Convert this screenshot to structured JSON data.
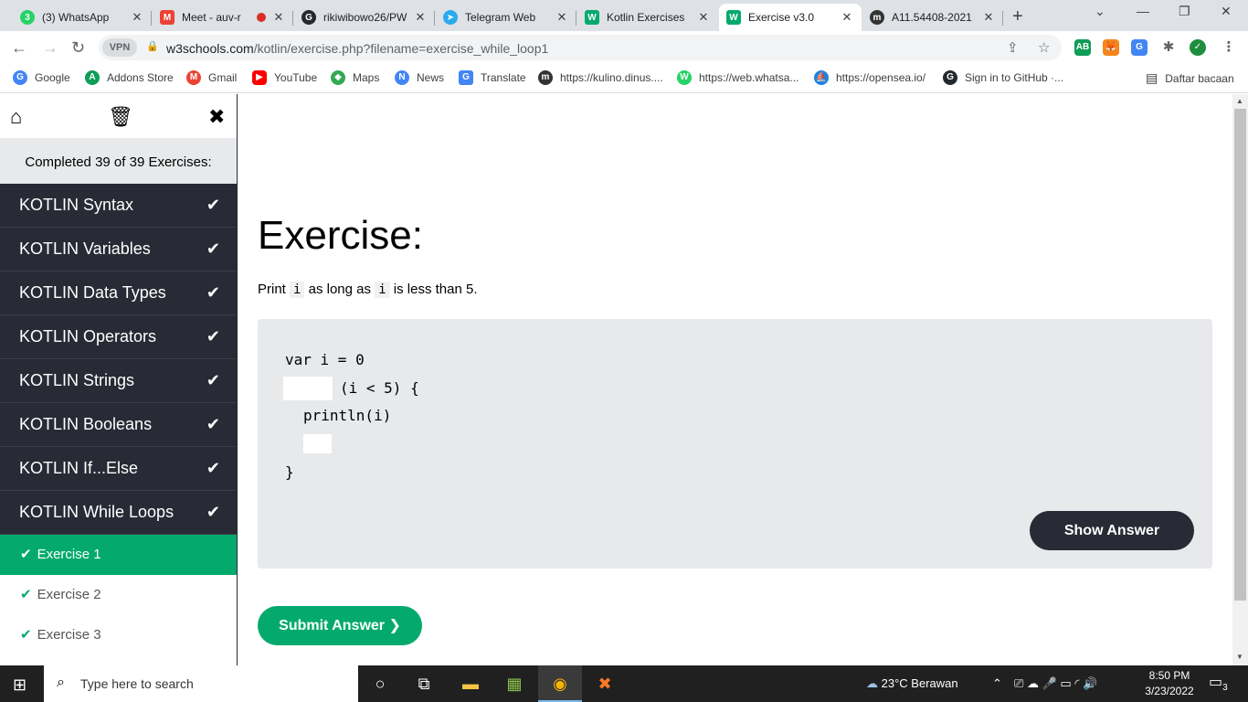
{
  "browser": {
    "tabs": [
      {
        "title": "(3) WhatsApp",
        "icon": "whatsapp-icon",
        "color": "#25d366",
        "glyph": "3"
      },
      {
        "title": "Meet - auv-r",
        "icon": "meet-icon",
        "color": "#ea4335",
        "glyph": "M"
      },
      {
        "title": "rikiwibowo26/PW",
        "icon": "github-icon",
        "color": "#24292e",
        "glyph": "G"
      },
      {
        "title": "Telegram Web",
        "icon": "telegram-icon",
        "color": "#2aabee",
        "glyph": "T"
      },
      {
        "title": "Kotlin Exercises",
        "icon": "w3schools-icon",
        "color": "#04aa6d",
        "glyph": "W"
      },
      {
        "title": "Exercise v3.0",
        "icon": "w3schools-icon",
        "color": "#04aa6d",
        "glyph": "W"
      },
      {
        "title": "A11.54408-2021",
        "icon": "moodle-icon",
        "color": "#333333",
        "glyph": "m"
      }
    ],
    "address": {
      "vpn_label": "VPN",
      "host": "w3schools.com",
      "path": "/kotlin/exercise.php?filename=exercise_while_loop1"
    },
    "bookmarks": [
      {
        "label": "Google",
        "icon": "google-icon",
        "color": "#4285f4",
        "glyph": "G"
      },
      {
        "label": "Addons Store",
        "icon": "addons-store-icon",
        "color": "#0f9d58",
        "glyph": "A"
      },
      {
        "label": "Gmail",
        "icon": "gmail-icon",
        "color": "#ea4335",
        "glyph": "M"
      },
      {
        "label": "YouTube",
        "icon": "youtube-icon",
        "color": "#ff0000",
        "glyph": "▶"
      },
      {
        "label": "Maps",
        "icon": "maps-icon",
        "color": "#34a853",
        "glyph": "◆"
      },
      {
        "label": "News",
        "icon": "news-icon",
        "color": "#4285f4",
        "glyph": "N"
      },
      {
        "label": "Translate",
        "icon": "translate-icon",
        "color": "#4285f4",
        "glyph": "G"
      },
      {
        "label": "https://kulino.dinus....",
        "icon": "moodle-icon",
        "color": "#333333",
        "glyph": "m"
      },
      {
        "label": "https://web.whatsa...",
        "icon": "whatsapp-icon",
        "color": "#25d366",
        "glyph": "W"
      },
      {
        "label": "https://opensea.io/",
        "icon": "opensea-icon",
        "color": "#2081e2",
        "glyph": "⛵"
      },
      {
        "label": "Sign in to GitHub ·...",
        "icon": "github-icon",
        "color": "#24292e",
        "glyph": "G"
      }
    ],
    "reading_list_label": "Daftar bacaan"
  },
  "sidebar": {
    "completed_text": "Completed 39 of 39 Exercises:",
    "lessons": [
      "KOTLIN Syntax",
      "KOTLIN Variables",
      "KOTLIN Data Types",
      "KOTLIN Operators",
      "KOTLIN Strings",
      "KOTLIN Booleans",
      "KOTLIN If...Else",
      "KOTLIN While Loops"
    ],
    "exercises": [
      "Exercise 1",
      "Exercise 2",
      "Exercise 3"
    ],
    "active_exercise": "Exercise 1"
  },
  "main": {
    "title": "Exercise:",
    "desc_before": "Print",
    "desc_var": "i",
    "desc_middle": "as long as",
    "desc_var2": "i",
    "desc_after": "is less than 5.",
    "code": {
      "line1": "var i = 0",
      "line2_after_blank": "(i < 5) {",
      "line3": "println(i)",
      "line5": "}"
    },
    "show_answer_label": "Show Answer",
    "submit_label": "Submit Answer ❯"
  },
  "taskbar": {
    "search_placeholder": "Type here to search",
    "weather": "23°C  Berawan",
    "time": "8:50 PM",
    "date": "3/23/2022",
    "notification_count": "3"
  },
  "colors": {
    "accent_green": "#04aa6d",
    "dark": "#282a35",
    "code_bg": "#e7e9eb"
  }
}
